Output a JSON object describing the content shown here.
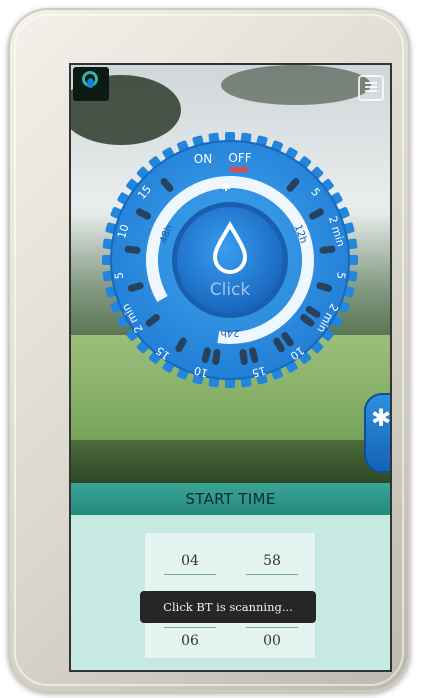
{
  "app": {
    "dial": {
      "on_label": "ON",
      "off_label": "OFF",
      "center_label": "Click",
      "inner_labels": [
        "48h",
        "12h",
        "24h"
      ],
      "outer_labels": [
        "15",
        "10",
        "5",
        "2 min",
        "15",
        "10",
        "5",
        "2 min",
        "5",
        "2 min",
        "10",
        "15"
      ],
      "bluetooth_glyph": "✱"
    },
    "start_time": {
      "title": "START TIME",
      "hour_top": "04",
      "minute_top": "58",
      "hour_bottom": "06",
      "minute_bottom": "00"
    },
    "toast": {
      "text": "Click BT is scanning..."
    },
    "bluetooth_badge": {
      "glyph": "✱"
    },
    "colors": {
      "dial_blue": "#2b8fe3",
      "dial_dark": "#1666b9",
      "band_teal": "#34a093",
      "panel_mint": "#c6e9e2",
      "off_indicator": "#e14a4a"
    },
    "icons": [
      "app-logo-icon",
      "menu-icon",
      "drop-icon",
      "bluetooth-icon"
    ]
  }
}
